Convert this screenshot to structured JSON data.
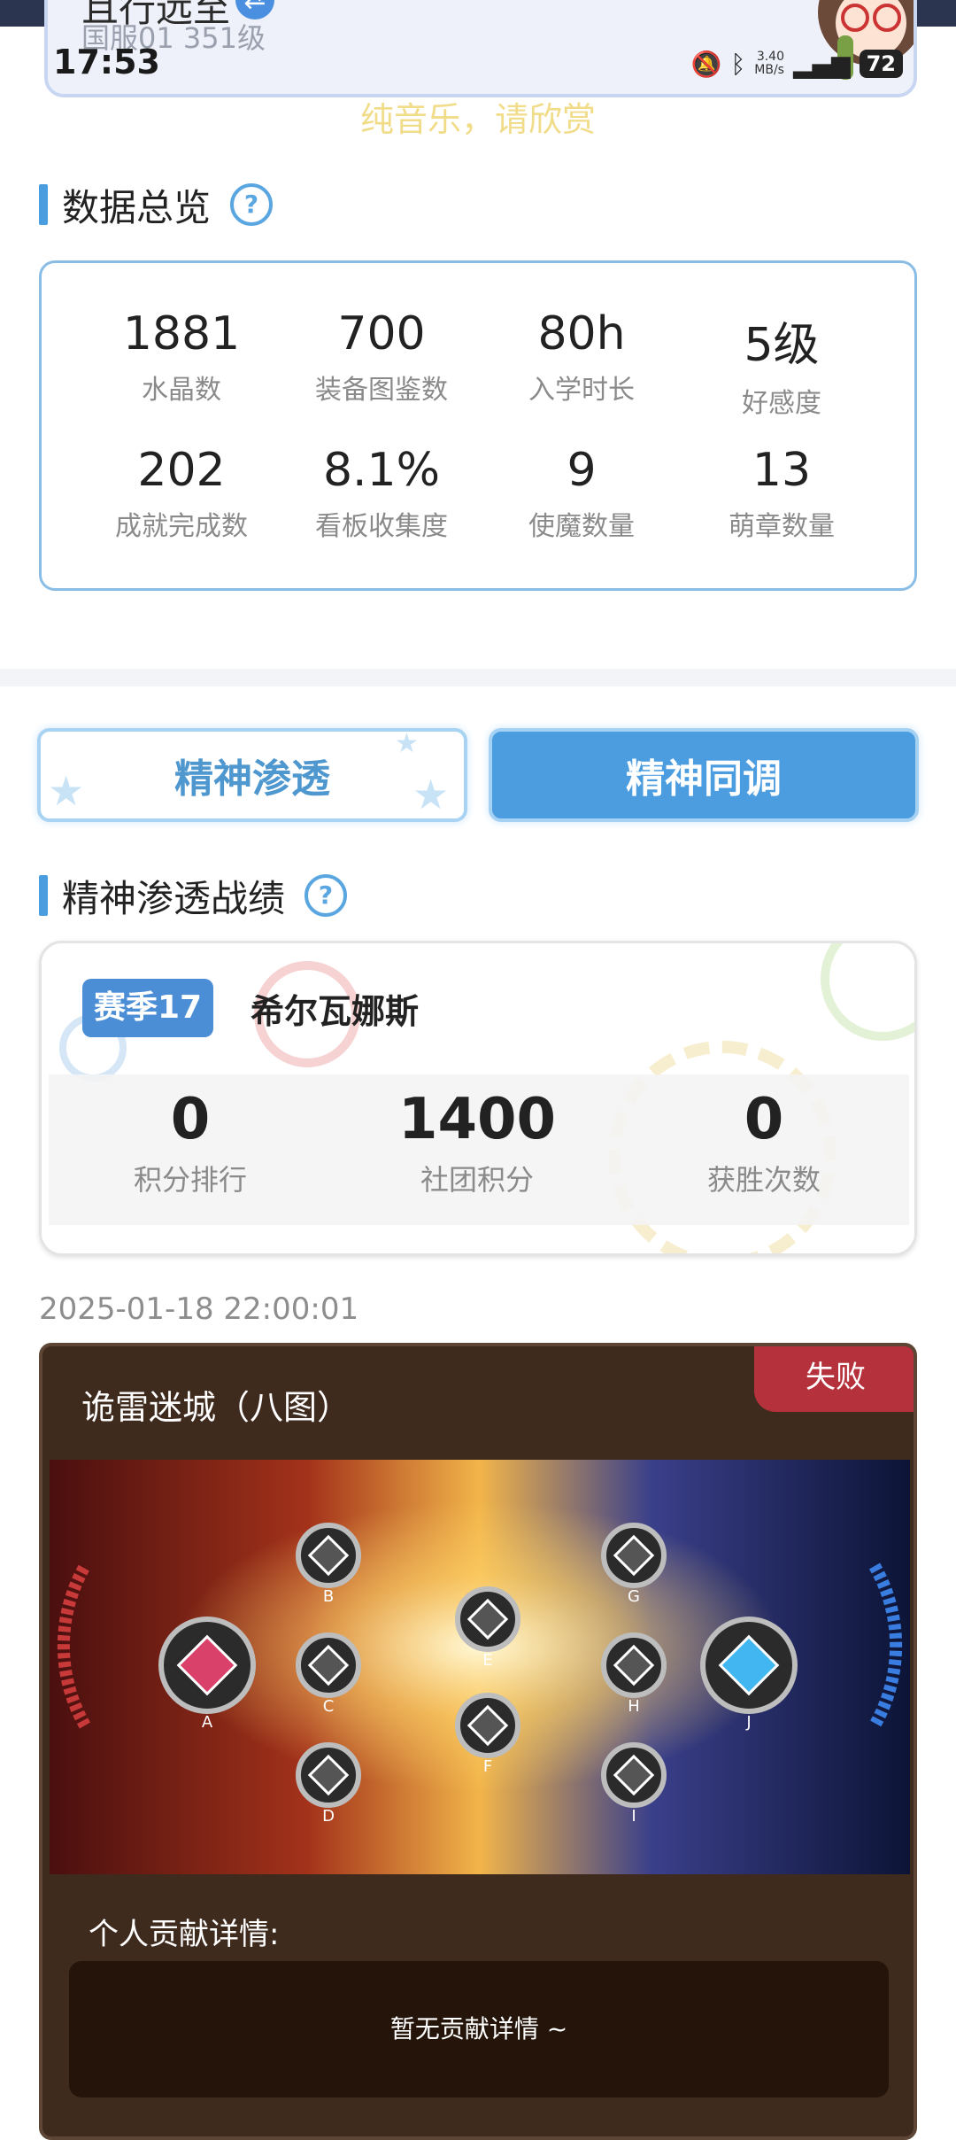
{
  "status_bar": {
    "time": "17:53",
    "net_speed_top": "3.40",
    "net_speed_bottom": "MB/s",
    "battery": "72"
  },
  "profile": {
    "name": "且行远至",
    "server_level": "国服01 351级"
  },
  "banner_text": "纯音乐，请欣赏",
  "overview": {
    "title": "数据总览",
    "stats": [
      {
        "value": "1881",
        "label": "水晶数"
      },
      {
        "value": "700",
        "label": "装备图鉴数"
      },
      {
        "value": "80h",
        "label": "入学时长"
      },
      {
        "value": "5级",
        "label": "好感度"
      },
      {
        "value": "202",
        "label": "成就完成数"
      },
      {
        "value": "8.1%",
        "label": "看板收集度"
      },
      {
        "value": "9",
        "label": "使魔数量"
      },
      {
        "value": "13",
        "label": "萌章数量"
      }
    ]
  },
  "tabs": [
    {
      "label": "精神渗透"
    },
    {
      "label": "精神同调"
    }
  ],
  "record": {
    "title": "精神渗透战绩",
    "season_badge": "赛季17",
    "season_name": "希尔瓦娜斯",
    "stats": [
      {
        "value": "0",
        "label": "积分排行"
      },
      {
        "value": "1400",
        "label": "社团积分"
      },
      {
        "value": "0",
        "label": "获胜次数"
      }
    ]
  },
  "battle": {
    "datetime": "2025-01-18 22:00:01",
    "map_name": "诡雷迷城（八图）",
    "result": "失败",
    "nodes": [
      "A",
      "B",
      "C",
      "D",
      "E",
      "F",
      "G",
      "H",
      "I",
      "J"
    ],
    "contrib_label": "个人贡献详情:",
    "contrib_empty": "暂无贡献详情 ~"
  },
  "colors": {
    "accent": "#4c9de0",
    "fail": "#b5323c",
    "card_bg": "#3f2a1e"
  }
}
